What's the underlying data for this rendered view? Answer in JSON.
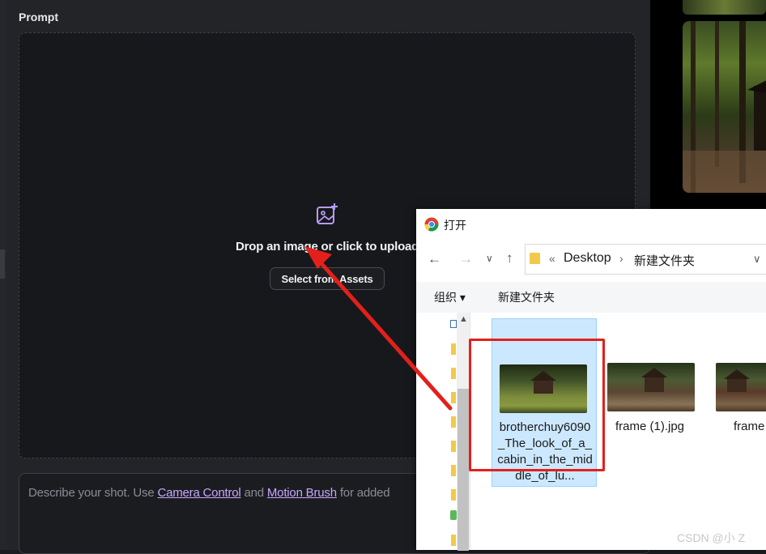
{
  "app": {
    "prompt_label": "Prompt",
    "drop_text": "Drop an image or click to upload",
    "select_assets_label": "Select from Assets",
    "prompt_placeholder_prefix": "Describe your shot. Use ",
    "camera_control_link": "Camera Control",
    "prompt_and": " and ",
    "motion_brush_link": "Motion Brush",
    "prompt_placeholder_suffix": " for added"
  },
  "dialog": {
    "title": "打开",
    "breadcrumb": {
      "chevron": "«",
      "root": "Desktop",
      "separator": "›",
      "current": "新建文件夹"
    },
    "toolbar": {
      "organize_label": "组织 ▾",
      "new_folder_label": "新建文件夹"
    },
    "files": [
      {
        "name": "brotherchuy6090_The_look_of_a_cabin_in_the_middle_of_lu...",
        "selected": true
      },
      {
        "name": "frame (1).jpg",
        "selected": false
      },
      {
        "name": "frame",
        "selected": false
      }
    ]
  },
  "watermark": "CSDN @小 Z",
  "colors": {
    "annotation_red": "#e3201b",
    "link_purple": "#c7a8ff",
    "selection_blue": "#cce8ff"
  },
  "icons": [
    "image-plus-icon",
    "chrome-icon",
    "back-arrow-icon",
    "forward-arrow-icon",
    "up-arrow-icon",
    "folder-icon",
    "chevron-down-icon"
  ]
}
